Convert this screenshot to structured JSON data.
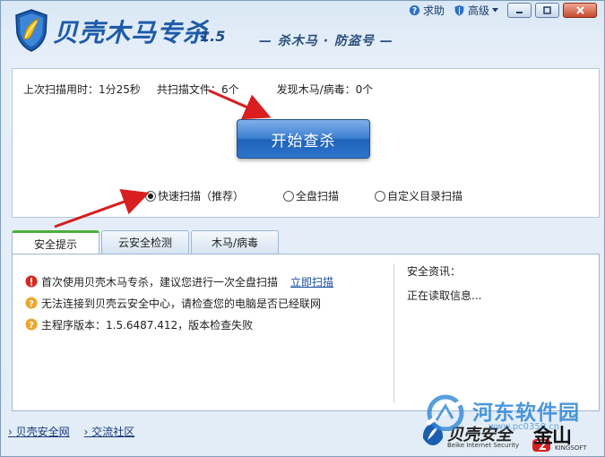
{
  "header": {
    "title": "贝壳木马专杀",
    "version": "1.5",
    "slogan": "— 杀木马 · 防盗号 —",
    "help_label": "求助",
    "advanced_label": "高级"
  },
  "scan": {
    "last_scan_time_label": "上次扫描用时：",
    "last_scan_time_value": "1分25秒",
    "files_scanned_label": "共扫描文件：",
    "files_scanned_value": "6个",
    "found_label": "发现木马/病毒：",
    "found_value": "0个",
    "start_button": "开始查杀",
    "options": [
      {
        "label": "快速扫描（推荐）",
        "selected": true
      },
      {
        "label": "全盘扫描",
        "selected": false
      },
      {
        "label": "自定义目录扫描",
        "selected": false
      }
    ]
  },
  "tabs": [
    {
      "label": "安全提示",
      "active": true
    },
    {
      "label": "云安全检测",
      "active": false
    },
    {
      "label": "木马/病毒",
      "active": false
    }
  ],
  "tips": [
    {
      "icon": "error-icon",
      "text": "首次使用贝壳木马专杀，建议您进行一次全盘扫描",
      "link": "立即扫描"
    },
    {
      "icon": "question-icon",
      "text": "无法连接到贝壳云安全中心，请检查您的电脑是否已经联网"
    },
    {
      "icon": "question-icon",
      "text": "主程序版本：1.5.6487.412，版本检查失败"
    }
  ],
  "news": {
    "title": "安全资讯：",
    "body": "正在读取信息..."
  },
  "footer": {
    "link1": "贝壳安全网",
    "link2": "交流社区"
  },
  "brand": {
    "kb": "贝壳安全",
    "kb_en": "Beike Internet Security",
    "ks": "金山",
    "ks_en": "KINGSOFT"
  },
  "watermark": {
    "text": "河东软件园",
    "url": "www.pc0359.cn"
  },
  "colors": {
    "accent": "#1e5aa8",
    "button": "#2d74cc",
    "tab_active": "#4caf3a",
    "arrow": "#d81e1e"
  }
}
